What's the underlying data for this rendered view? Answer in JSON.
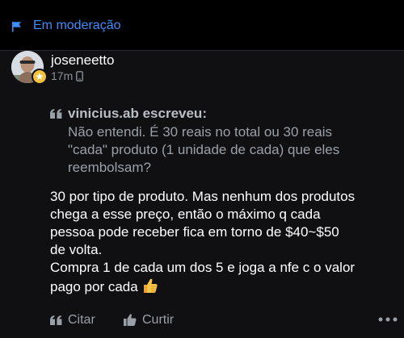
{
  "moderation": {
    "label": "Em moderação",
    "icon": "flag-icon"
  },
  "post": {
    "author": "joseneetto",
    "time": "17m",
    "quote": {
      "author": "vinicius.ab escreveu:",
      "text": "Não entendi. É 30 reais no total ou 30 reais\n\"cada\" produto (1 unidade de cada) que eles\nreembolsam?"
    },
    "body": "30 por tipo de produto. Mas nenhum dos produtos\nchega a esse preço, então o máximo q cada\npessoa pode receber fica em torno de $40~$50\nde volta.\nCompra 1 de cada um dos 5 e joga a nfe c o valor\npago por cada"
  },
  "actions": {
    "quote_label": "Citar",
    "like_label": "Curtir"
  },
  "colors": {
    "accent": "#3d8eff",
    "badge": "#f2c13d",
    "background": "#000000",
    "card": "#101012"
  }
}
